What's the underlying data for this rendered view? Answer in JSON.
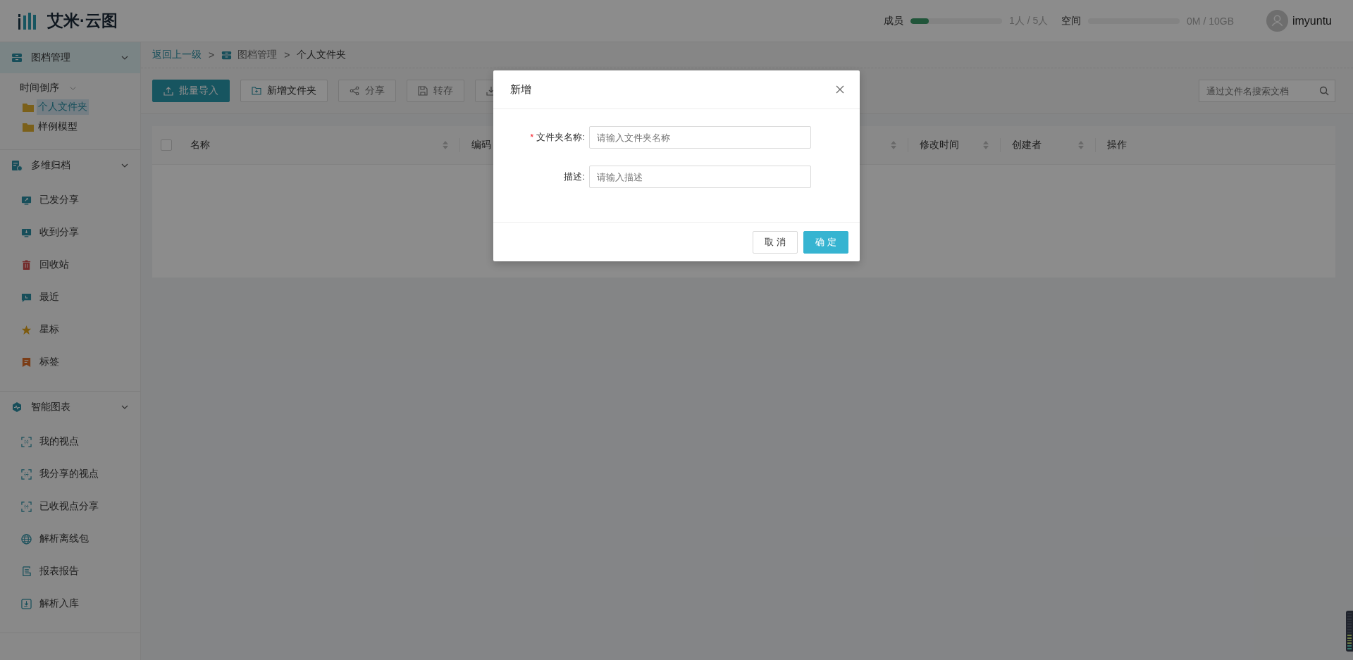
{
  "header": {
    "logo_text": "艾米·云图",
    "members": {
      "label": "成员",
      "level": 0.2,
      "reading": "1人 / 5人"
    },
    "space": {
      "label": "空间",
      "level": 0,
      "reading": "0M / 10GB"
    },
    "user": "imyuntu"
  },
  "sidebar": {
    "groups": [
      {
        "title": "图档管理",
        "selected": true,
        "expanded": true,
        "tree": [
          {
            "label": "时间倒序",
            "expanded": true,
            "children": [
              {
                "label": "个人文件夹",
                "selected": true
              },
              {
                "label": "样例模型",
                "selected": false
              }
            ]
          }
        ]
      },
      {
        "title": "多维归档",
        "selected": false,
        "expanded": true,
        "items": [
          {
            "label": "已发分享",
            "selected": false
          },
          {
            "label": "收到分享",
            "selected": false
          },
          {
            "label": "回收站",
            "selected": false
          },
          {
            "label": "最近",
            "selected": false
          },
          {
            "label": "星标",
            "selected": false
          },
          {
            "label": "标签",
            "selected": false
          }
        ]
      },
      {
        "title": "智能图表",
        "selected": false,
        "expanded": true,
        "items": [
          {
            "label": "我的视点",
            "selected": false
          },
          {
            "label": "我分享的视点",
            "selected": false
          },
          {
            "label": "已收视点分享",
            "selected": false
          },
          {
            "label": "解析离线包",
            "selected": false
          },
          {
            "label": "报表报告",
            "selected": false
          },
          {
            "label": "解析入库",
            "selected": false
          }
        ]
      }
    ]
  },
  "breadcrumb": [
    {
      "kind": "link",
      "label": "返回上一级"
    },
    {
      "kind": "separator",
      "label": ">"
    },
    {
      "kind": "folder",
      "label": "图档管理"
    },
    {
      "kind": "separator",
      "label": ">"
    },
    {
      "kind": "current",
      "label": "个人文件夹"
    }
  ],
  "toolbar": {
    "buttons": [
      {
        "kind": "primary",
        "label": "批量导入",
        "disabled": false
      },
      {
        "kind": "default",
        "label": "新增文件夹",
        "disabled": false
      },
      {
        "kind": "default",
        "label": "分享",
        "disabled": true
      },
      {
        "kind": "default",
        "label": "转存",
        "disabled": true
      },
      {
        "kind": "default",
        "disabled": true
      }
    ],
    "search": {
      "placeholder": "通过文件名搜索文档"
    }
  },
  "table": {
    "select_all": {
      "checked": false
    },
    "columns": [
      {
        "label": "名称",
        "sortable": true
      },
      {
        "label": "编码",
        "sortable": false
      },
      {
        "sortable": true
      },
      {
        "label": "修改时间",
        "sortable": true
      },
      {
        "label": "创建者",
        "sortable": true
      },
      {
        "label": "操作",
        "sortable": false
      }
    ]
  },
  "dialog": {
    "title": "新增",
    "fields": [
      {
        "required_mark": "*",
        "label": "文件夹名称:",
        "placeholder": "请输入文件夹名称"
      },
      {
        "label": "描述:",
        "placeholder": "请输入描述"
      }
    ],
    "buttons": [
      {
        "kind": "default",
        "label": "取 消"
      },
      {
        "kind": "primary",
        "label": "确 定"
      }
    ]
  }
}
